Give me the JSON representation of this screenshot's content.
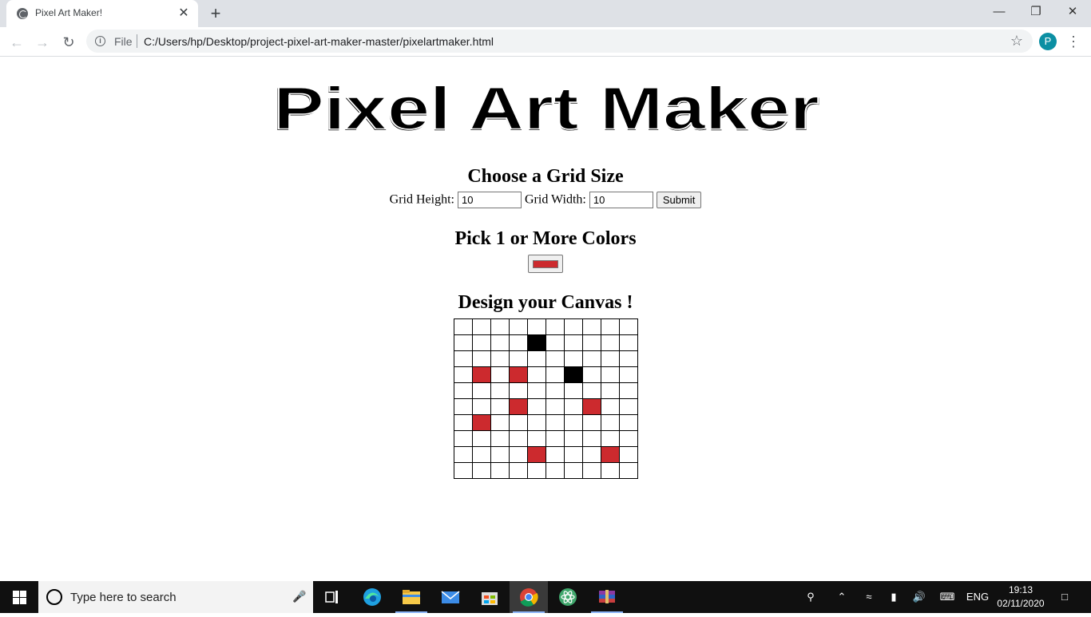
{
  "browser": {
    "tab_title": "Pixel Art Maker!",
    "tab_close": "✕",
    "new_tab": "+",
    "file_label": "File",
    "url": "C:/Users/hp/Desktop/project-pixel-art-maker-master/pixelartmaker.html",
    "avatar_letter": "P"
  },
  "page": {
    "logo_text": "Pixel Art Maker",
    "grid_heading": "Choose a Grid Size",
    "height_label": "Grid Height:",
    "height_value": "10",
    "width_label": "Grid Width:",
    "width_value": "10",
    "submit_label": "Submit",
    "colors_heading": "Pick 1 or More Colors",
    "selected_color": "#cc2a2e",
    "canvas_heading": "Design your Canvas !"
  },
  "canvas": {
    "rows": 10,
    "cols": 10,
    "painted": [
      {
        "row": 1,
        "col": 4,
        "color": "#000000"
      },
      {
        "row": 3,
        "col": 1,
        "color": "#cc2a2e"
      },
      {
        "row": 3,
        "col": 3,
        "color": "#cc2a2e"
      },
      {
        "row": 3,
        "col": 6,
        "color": "#000000"
      },
      {
        "row": 5,
        "col": 3,
        "color": "#cc2a2e"
      },
      {
        "row": 5,
        "col": 7,
        "color": "#cc2a2e"
      },
      {
        "row": 6,
        "col": 1,
        "color": "#cc2a2e"
      },
      {
        "row": 8,
        "col": 4,
        "color": "#cc2a2e"
      },
      {
        "row": 8,
        "col": 8,
        "color": "#cc2a2e"
      }
    ]
  },
  "taskbar": {
    "search_placeholder": "Type here to search",
    "language": "ENG",
    "time": "19:13",
    "date": "02/11/2020"
  }
}
